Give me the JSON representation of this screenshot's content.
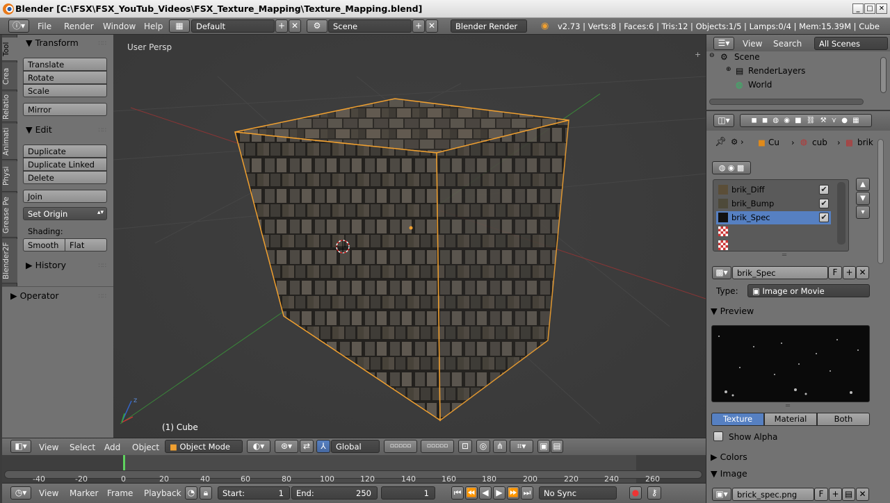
{
  "window": {
    "title": "Blender [C:\\FSX\\FSX_YouTub_Videos\\FSX_Texture_Mapping\\Texture_Mapping.blend]",
    "minimize": "_",
    "maximize": "□",
    "close": "✕"
  },
  "info": {
    "menus": [
      "File",
      "Render",
      "Window",
      "Help"
    ],
    "layout": "Default",
    "scene": "Scene",
    "engine": "Blender Render",
    "stats": "v2.73 | Verts:8 | Faces:6 | Tris:12 | Objects:1/5 | Lamps:0/4 | Mem:15.39M | Cube"
  },
  "toolshelf": {
    "tabs": [
      "Tool",
      "Crea",
      "Relatio",
      "Animati",
      "Physi",
      "Grease Pe",
      "Blender2F"
    ],
    "transform_label": "Transform",
    "translate": "Translate",
    "rotate": "Rotate",
    "scale": "Scale",
    "mirror": "Mirror",
    "edit_label": "Edit",
    "duplicate": "Duplicate",
    "duplicate_linked": "Duplicate Linked",
    "delete": "Delete",
    "join": "Join",
    "set_origin": "Set Origin",
    "shading_label": "Shading:",
    "smooth": "Smooth",
    "flat": "Flat",
    "history_label": "History",
    "operator_label": "Operator"
  },
  "viewport": {
    "view_label": "User Persp",
    "object_label": "(1) Cube",
    "axis_z": "z"
  },
  "view3d_header": {
    "menus": [
      "View",
      "Select",
      "Add",
      "Object"
    ],
    "mode": "Object Mode",
    "orientation": "Global"
  },
  "timeline": {
    "ticks": [
      "-40",
      "-20",
      "0",
      "20",
      "40",
      "60",
      "80",
      "100",
      "120",
      "140",
      "160",
      "180",
      "200",
      "220",
      "240",
      "260"
    ],
    "menus": [
      "View",
      "Marker",
      "Frame",
      "Playback"
    ],
    "start_label": "Start:",
    "start_value": "1",
    "end_label": "End:",
    "end_value": "250",
    "current_frame": "1",
    "sync": "No Sync"
  },
  "outliner": {
    "view": "View",
    "search": "Search",
    "filter": "All Scenes",
    "items": [
      "Scene",
      "RenderLayers",
      "World"
    ]
  },
  "properties": {
    "breadcrumb": [
      "Cu",
      "cub",
      "brik"
    ],
    "texture_slots": [
      {
        "name": "brik_Diff",
        "checked": true,
        "selected": false
      },
      {
        "name": "brik_Bump",
        "checked": true,
        "selected": false
      },
      {
        "name": "brik_Spec",
        "checked": true,
        "selected": true
      },
      {
        "name": "",
        "checked": false,
        "selected": false
      },
      {
        "name": "",
        "checked": false,
        "selected": false
      }
    ],
    "texture_name": "brik_Spec",
    "fake_user": "F",
    "type_label": "Type:",
    "type_value": "Image or Movie",
    "preview_label": "Preview",
    "preview_tabs": [
      "Texture",
      "Material",
      "Both"
    ],
    "show_alpha": "Show Alpha",
    "colors_label": "Colors",
    "image_label": "Image",
    "image_name": "brick_spec.png"
  },
  "colors": {
    "accent_blue": "#5680c2",
    "selection_orange": "#f0a030",
    "header_grey": "#727272"
  }
}
